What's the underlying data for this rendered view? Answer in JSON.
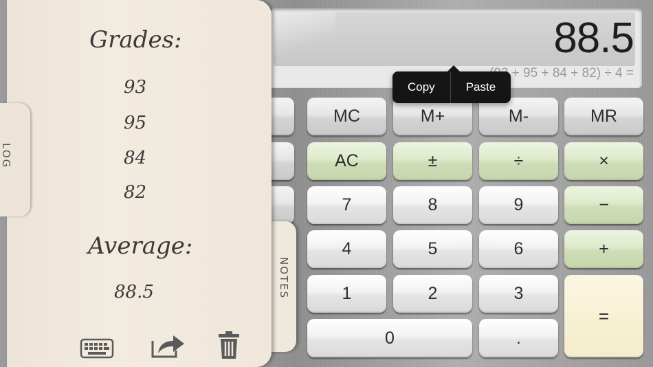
{
  "display": {
    "value": "88.5",
    "expression": "(93 + 95 + 84 + 82) ÷ 4 ="
  },
  "context_menu": {
    "copy_label": "Copy",
    "paste_label": "Paste"
  },
  "keys": {
    "mc": "MC",
    "mplus": "M+",
    "mminus": "M-",
    "mr": "MR",
    "ac": "AC",
    "plusminus": "±",
    "divide": "÷",
    "multiply": "×",
    "seven": "7",
    "eight": "8",
    "nine": "9",
    "minus": "−",
    "four": "4",
    "five": "5",
    "six": "6",
    "plus": "+",
    "one": "1",
    "two": "2",
    "three": "3",
    "equals": "=",
    "zero": "0",
    "decimal": "."
  },
  "notes": {
    "log_tab": "LOG",
    "notes_tab": "NOTES",
    "grades_title": "Grades:",
    "grades": [
      "93",
      "95",
      "84",
      "82"
    ],
    "average_title": "Average:",
    "average_value": "88.5"
  },
  "toolbar_icons": [
    "keyboard-icon",
    "share-icon",
    "trash-icon"
  ],
  "colors": {
    "operator_key": "#d7e5c2",
    "equals_key": "#f6efd2",
    "paper": "#efe8dc"
  }
}
